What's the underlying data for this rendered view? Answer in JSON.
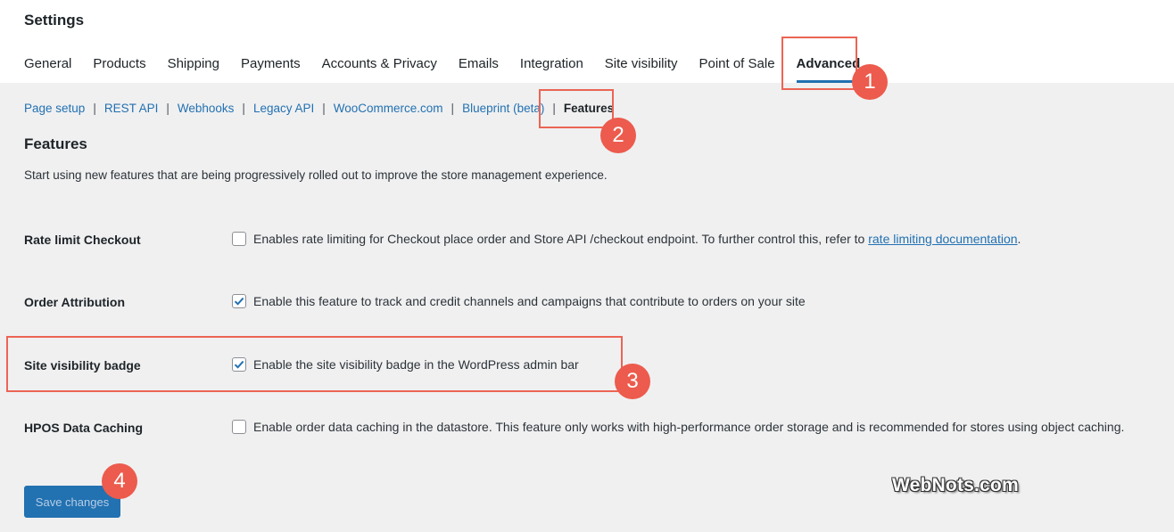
{
  "header": {
    "title": "Settings",
    "tabs": [
      {
        "label": "General"
      },
      {
        "label": "Products"
      },
      {
        "label": "Shipping"
      },
      {
        "label": "Payments"
      },
      {
        "label": "Accounts & Privacy"
      },
      {
        "label": "Emails"
      },
      {
        "label": "Integration"
      },
      {
        "label": "Site visibility"
      },
      {
        "label": "Point of Sale"
      },
      {
        "label": "Advanced",
        "active": true
      }
    ]
  },
  "subnav": {
    "items": [
      "Page setup",
      "REST API",
      "Webhooks",
      "Legacy API",
      "WooCommerce.com",
      "Blueprint (beta)"
    ],
    "separator": "|",
    "current": "Features"
  },
  "section": {
    "title": "Features",
    "description": "Start using new features that are being progressively rolled out to improve the store management experience."
  },
  "features": [
    {
      "label": "Rate limit Checkout",
      "checked": false,
      "text": "Enables rate limiting for Checkout place order and Store API /checkout endpoint. To further control this, refer to ",
      "link": "rate limiting documentation",
      "suffix": "."
    },
    {
      "label": "Order Attribution",
      "checked": true,
      "text": "Enable this feature to track and credit channels and campaigns that contribute to orders on your site"
    },
    {
      "label": "Site visibility badge",
      "checked": true,
      "text": "Enable the site visibility badge in the WordPress admin bar"
    },
    {
      "label": "HPOS Data Caching",
      "checked": false,
      "text": "Enable order data caching in the datastore. This feature only works with high-performance order storage and is recommended for stores using object caching."
    }
  ],
  "save_button": "Save changes",
  "callouts": [
    "1",
    "2",
    "3",
    "4"
  ],
  "watermark": "WebNots.com",
  "colors": {
    "accent": "#2271b1",
    "highlight": "#ec6454",
    "badge": "#ec5b4d"
  }
}
